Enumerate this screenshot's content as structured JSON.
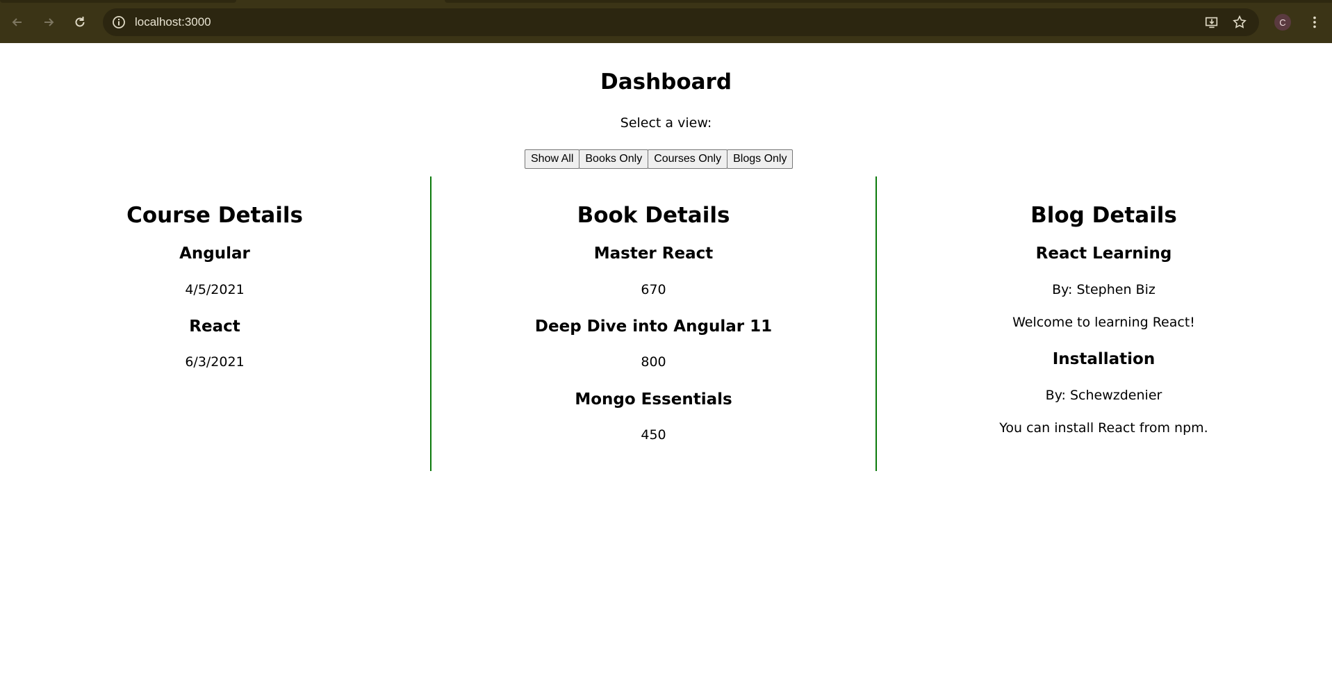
{
  "browser": {
    "url": "localhost:3000",
    "profile_initial": "C",
    "icons": [
      "back-icon",
      "forward-icon",
      "reload-icon",
      "site-info-icon",
      "install-app-icon",
      "bookmark-star-icon",
      "kebab-menu-icon"
    ]
  },
  "page": {
    "title": "Dashboard",
    "select_label": "Select a view:",
    "buttons": {
      "show_all": "Show All",
      "books_only": "Books Only",
      "courses_only": "Courses Only",
      "blogs_only": "Blogs Only"
    }
  },
  "courses": {
    "heading": "Course Details",
    "items": [
      {
        "name": "Angular",
        "date": "4/5/2021"
      },
      {
        "name": "React",
        "date": "6/3/2021"
      }
    ]
  },
  "books": {
    "heading": "Book Details",
    "items": [
      {
        "name": "Master React",
        "price": "670"
      },
      {
        "name": "Deep Dive into Angular 11",
        "price": "800"
      },
      {
        "name": "Mongo Essentials",
        "price": "450"
      }
    ]
  },
  "blogs": {
    "heading": "Blog Details",
    "items": [
      {
        "title": "React Learning",
        "author": "By: Stephen Biz",
        "content": "Welcome to learning React!"
      },
      {
        "title": "Installation",
        "author": "By: Schewzdenier",
        "content": "You can install React from npm."
      }
    ]
  },
  "colors": {
    "chrome_bg": "#3b3416",
    "divider": "#0b7a0b"
  }
}
